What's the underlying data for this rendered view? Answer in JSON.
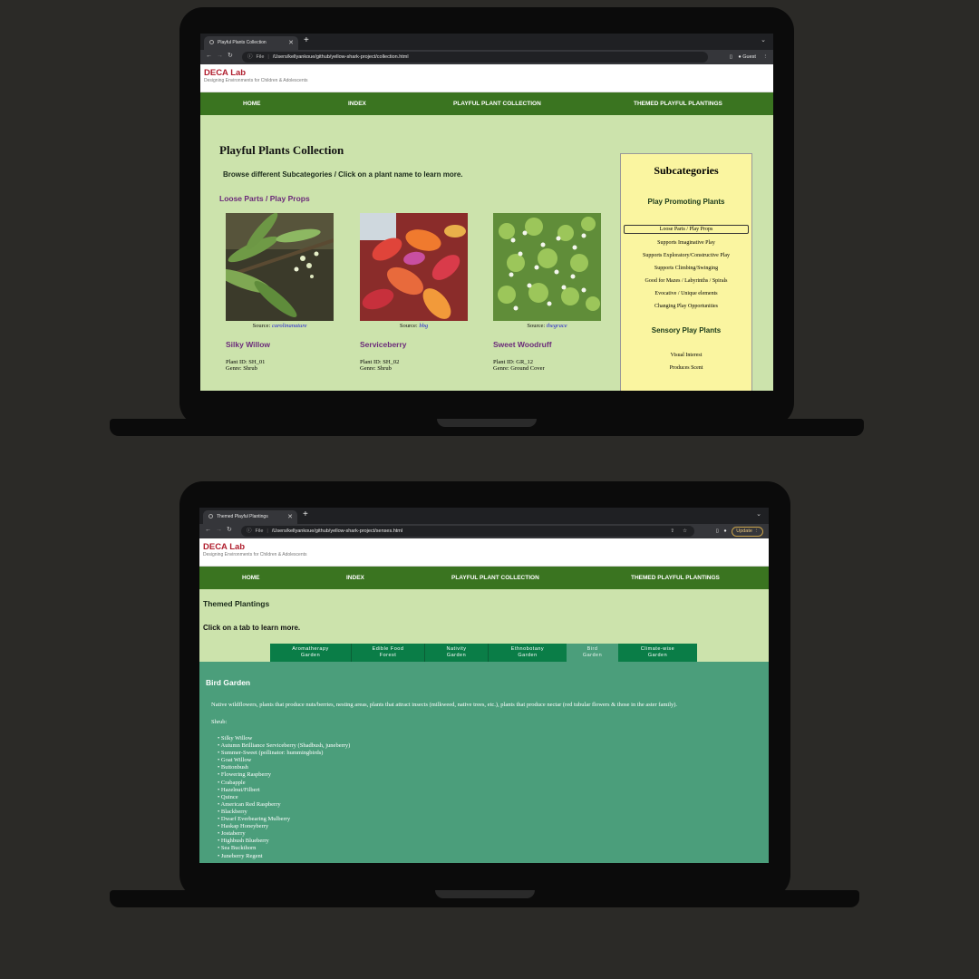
{
  "laptop1": {
    "tab_title": "Playful Plants Collection",
    "address_label": "File",
    "url": "/Users/kellyankoue/github/yellow-shark-project/collection.html",
    "profile_label": "Guest",
    "logo_title": "DECA Lab",
    "logo_subtitle": "Designing Environments for Children & Adolescents",
    "menu": [
      "HOME",
      "INDEX",
      "PLAYFUL PLANT COLLECTION",
      "THEMED PLAYFUL PLANTINGS"
    ],
    "page_title": "Playful Plants Collection",
    "instructions": "Browse different Subcategories / Click on a plant name to learn more.",
    "section_title": "Loose Parts / Play Props",
    "plants": [
      {
        "source_label": "Source:",
        "source": "carolinanature",
        "name": "Silky Willow",
        "plant_id": "Plant ID: SH_01",
        "genre": "Genre: Shrub",
        "image": "willow-photo"
      },
      {
        "source_label": "Source:",
        "source": "bbg",
        "name": "Serviceberry",
        "plant_id": "Plant ID: SH_02",
        "genre": "Genre: Shrub",
        "image": "serviceberry-photo"
      },
      {
        "source_label": "Source:",
        "source": "thegrace",
        "name": "Sweet Woodruff",
        "plant_id": "Plant ID: GR_12",
        "genre": "Genre: Ground Cover",
        "image": "woodruff-photo"
      }
    ],
    "sidebar": {
      "title": "Subcategories",
      "group1_title": "Play Promoting Plants",
      "group1_items": [
        "Loose Parts / Play Props",
        "Supports Imaginative Play",
        "Supports Exploratory/Constructive Play",
        "Supports Climbing/Swinging",
        "Good for Mazes / Labyrinths / Spirals",
        "Evocative / Unique elements",
        "Changing Play Opportunities"
      ],
      "group2_title": "Sensory Play Plants",
      "group2_items": [
        "Visual Interest",
        "Produces Scent"
      ]
    }
  },
  "laptop2": {
    "tab_title": "Themed Playful Plantings",
    "address_label": "File",
    "url": "/Users/kellyankoue/github/yellow-shark-project/senses.html",
    "update_label": "Update",
    "logo_title": "DECA Lab",
    "logo_subtitle": "Designing Environments for Children & Adolescents",
    "menu": [
      "HOME",
      "INDEX",
      "PLAYFUL PLANT COLLECTION",
      "THEMED PLAYFUL PLANTINGS"
    ],
    "heading": "Themed Plantings",
    "instructions": "Click on a tab to learn more.",
    "tabs": [
      {
        "line1": "Aromatherapy",
        "line2": "Garden"
      },
      {
        "line1": "Edible Food",
        "line2": "Forest"
      },
      {
        "line1": "Nativity",
        "line2": "Garden"
      },
      {
        "line1": "Ethnobotany",
        "line2": "Garden"
      },
      {
        "line1": "Bird",
        "line2": "Garden"
      },
      {
        "line1": "Climate-wise",
        "line2": "Garden"
      }
    ],
    "panel_title": "Bird Garden",
    "panel_description": "Native wildflowers, plants that produce nuts/berries, nesting areas, plants that attract insects (milkweed, native trees, etc.), plants that produce nectar (red tubular flowers & those in the aster family).",
    "list_heading": "Shrub:",
    "shrubs": [
      "Silky Willow",
      "Autumn Brilliance Serviceberry (Shadbush, juneberry)",
      "Summer-Sweet (pollinator: hummingbirds)",
      "Goat Willow",
      "Buttonbush",
      "Flowering Raspberry",
      "Crabapple",
      "Hazelnut/Filbert",
      "Quince",
      "American Red Raspberry",
      "Blackberry",
      "Dwarf Everbearing Mulberry",
      "Haskap Honeyberry",
      "Jostaberry",
      "Highbush Blueberry",
      "Sea Buckthorn",
      "Juneberry Regent"
    ]
  },
  "colors": {
    "background": "#2b2a27",
    "nav_green": "#3a7420",
    "page_green": "#cce3ac",
    "sidebar_yellow": "#faf5a0",
    "purple_heading": "#6b2a7a",
    "tab_green": "#0a7d47",
    "tab_active": "#4b9e7b",
    "panel_green": "#4b9e7b",
    "logo_red": "#b01e2e"
  }
}
